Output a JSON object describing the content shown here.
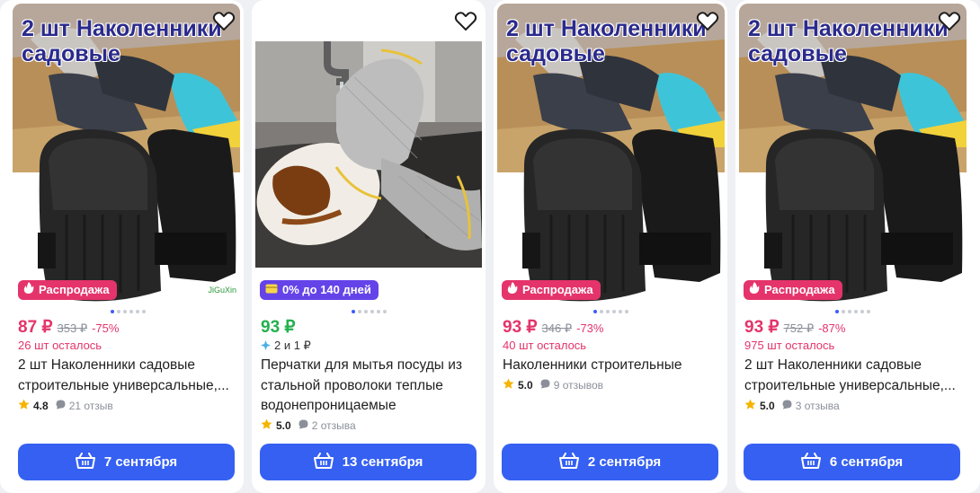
{
  "cards": [
    {
      "overlay_line1": "2 шт Наколенники",
      "overlay_line2": "садовые",
      "watermark": "JiGuXin",
      "badge": "Распродажа",
      "price": "87 ₽",
      "old_price": "353 ₽",
      "discount": "-75%",
      "stock": "26 шт осталось",
      "title_line1": "2 шт Наколенники садовые",
      "title_line2": "строительные универсальные,...",
      "rating": "4.8",
      "reviews": "21 отзыв",
      "delivery": "7 сентября"
    },
    {
      "badge": "0% до 140 дней",
      "price": "93 ₽",
      "split": "2 и 1 ₽",
      "title_line1": "Перчатки для мытья посуды из",
      "title_line2": "стальной проволоки теплые",
      "title_line3": "водонепроницаемые",
      "rating": "5.0",
      "reviews": "2 отзыва",
      "delivery": "13 сентября"
    },
    {
      "overlay_line1": "2 шт Наколенники",
      "overlay_line2": "садовые",
      "badge": "Распродажа",
      "price": "93 ₽",
      "old_price": "346 ₽",
      "discount": "-73%",
      "stock": "40 шт осталось",
      "title_line1": "Наколенники строительные",
      "rating": "5.0",
      "reviews": "9 отзывов",
      "delivery": "2 сентября"
    },
    {
      "overlay_line1": "2 шт Наколенники",
      "overlay_line2": "садовые",
      "badge": "Распродажа",
      "price": "93 ₽",
      "old_price": "752 ₽",
      "discount": "-87%",
      "stock": "975 шт осталось",
      "title_line1": "2 шт Наколенники садовые",
      "title_line2": "строительные универсальные,...",
      "rating": "5.0",
      "reviews": "3 отзыва",
      "delivery": "6 сентября"
    }
  ],
  "colors": {
    "accent": "#3560f2",
    "sale": "#e4346b",
    "credit": "#6443e8",
    "green_price": "#22b14c"
  },
  "icons": [
    "heart-icon",
    "fire-icon",
    "card-icon",
    "split-icon",
    "star-icon",
    "comment-icon",
    "basket-icon"
  ]
}
